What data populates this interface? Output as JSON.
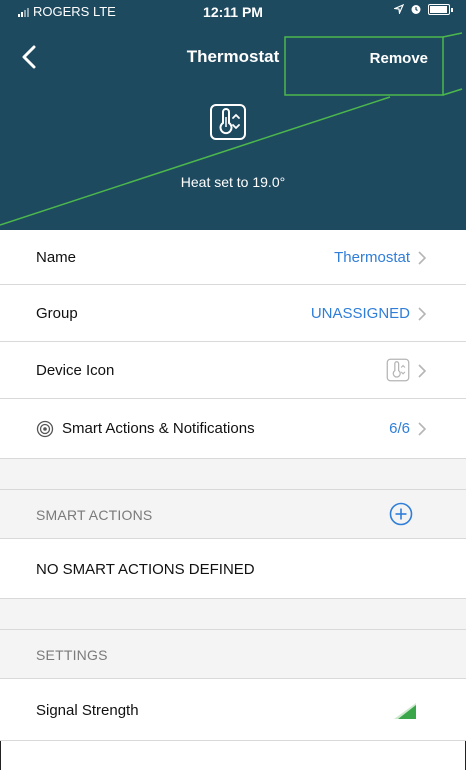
{
  "status_bar": {
    "carrier": "ROGERS  LTE",
    "time": "12:11 PM"
  },
  "nav": {
    "back_icon": "chevron-left-icon",
    "title": "Thermostat",
    "remove_label": "Remove"
  },
  "header": {
    "device_icon": "thermometer-icon",
    "heat_status": "Heat set to 19.0°",
    "background_color": "#1e4a60"
  },
  "rows": {
    "name": {
      "label": "Name",
      "value": "Thermostat"
    },
    "group": {
      "label": "Group",
      "value": "UNASSIGNED"
    },
    "device_icon": {
      "label": "Device Icon",
      "icon": "thermometer-icon"
    },
    "smart_actions_notifications": {
      "label": "Smart Actions & Notifications",
      "value": "6/6",
      "icon": "smart-actions-icon"
    }
  },
  "smart_actions_section": {
    "header": "SMART ACTIONS",
    "add_icon": "plus-circle-icon",
    "empty_text": "NO SMART ACTIONS DEFINED"
  },
  "settings_section": {
    "header": "SETTINGS",
    "signal_strength": {
      "label": "Signal Strength",
      "icon": "signal-strength-icon"
    }
  },
  "colors": {
    "accent": "#2f7ed8",
    "annotation": "#4cb84c",
    "signal": "#3aa64a"
  }
}
